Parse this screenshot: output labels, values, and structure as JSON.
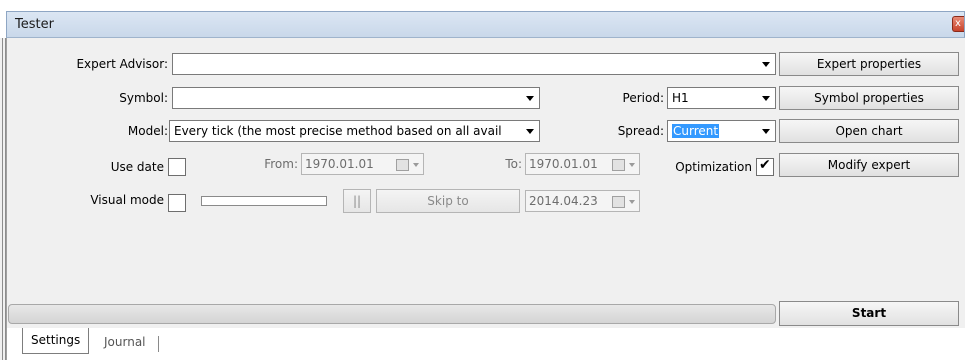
{
  "window": {
    "title": "Tester",
    "close_glyph": "x"
  },
  "form": {
    "expert_advisor_label": "Expert Advisor:",
    "expert_advisor_value": "",
    "symbol_label": "Symbol:",
    "symbol_value": "",
    "model_label": "Model:",
    "model_value": "Every tick (the most precise method based on all avail",
    "period_label": "Period:",
    "period_value": "H1",
    "spread_label": "Spread:",
    "spread_value": "Current",
    "use_date_label": "Use date",
    "use_date_checked": false,
    "from_label": "From:",
    "from_value": "1970.01.01",
    "to_label": "To:",
    "to_value": "1970.01.01",
    "optimization_label": "Optimization",
    "optimization_checked": true,
    "optimization_mark": "✔",
    "visual_mode_label": "Visual mode",
    "visual_mode_checked": false,
    "pause_label": "||",
    "skip_to_label": "Skip to",
    "skip_to_date": "2014.04.23"
  },
  "buttons": {
    "expert_properties": "Expert properties",
    "symbol_properties": "Symbol properties",
    "open_chart": "Open chart",
    "modify_expert": "Modify expert",
    "start": "Start"
  },
  "progress": {
    "value": 0
  },
  "tabs": [
    {
      "label": "Settings",
      "active": true
    },
    {
      "label": "Journal",
      "active": false
    }
  ],
  "colors": {
    "selection": "#3399ff",
    "title_bar": "#c9d8ea",
    "panel": "#f0f0f0"
  }
}
